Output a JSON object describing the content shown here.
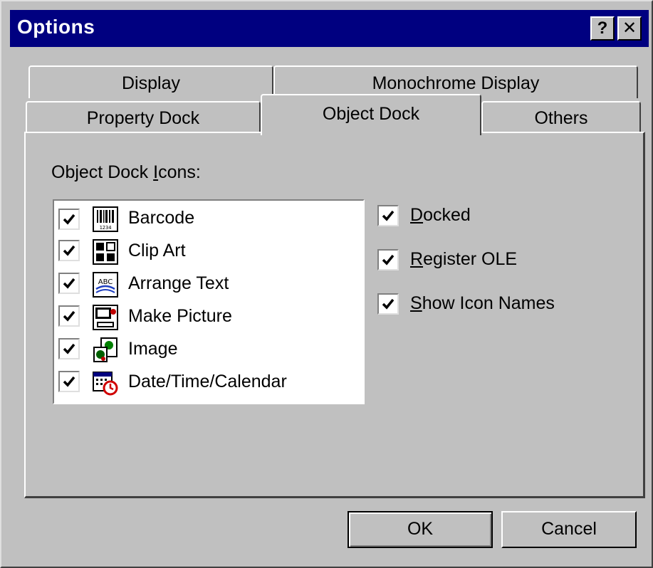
{
  "window": {
    "title": "Options",
    "help_button": "?",
    "close_button": "✕"
  },
  "tabs": {
    "row1": [
      {
        "label": "Display"
      },
      {
        "label": "Monochrome Display"
      }
    ],
    "row2": [
      {
        "label": "Property Dock"
      },
      {
        "label": "Object Dock",
        "selected": true
      },
      {
        "label": "Others"
      }
    ]
  },
  "object_dock": {
    "icons_label_pre": "Object Dock ",
    "icons_label_key": "I",
    "icons_label_post": "cons:",
    "items": [
      {
        "label": "Barcode",
        "checked": true,
        "icon": "barcode-icon"
      },
      {
        "label": "Clip Art",
        "checked": true,
        "icon": "clip-art-icon"
      },
      {
        "label": "Arrange Text",
        "checked": true,
        "icon": "arrange-text-icon"
      },
      {
        "label": "Make Picture",
        "checked": true,
        "icon": "make-picture-icon"
      },
      {
        "label": "Image",
        "checked": true,
        "icon": "image-icon"
      },
      {
        "label": "Date/Time/Calendar",
        "checked": true,
        "icon": "date-time-calendar-icon"
      }
    ],
    "options": [
      {
        "key": "D",
        "rest": "ocked",
        "checked": true
      },
      {
        "key": "R",
        "rest": "egister OLE",
        "checked": true
      },
      {
        "key": "S",
        "rest": "how Icon Names",
        "checked": true
      }
    ]
  },
  "buttons": {
    "ok": "OK",
    "cancel": "Cancel"
  }
}
